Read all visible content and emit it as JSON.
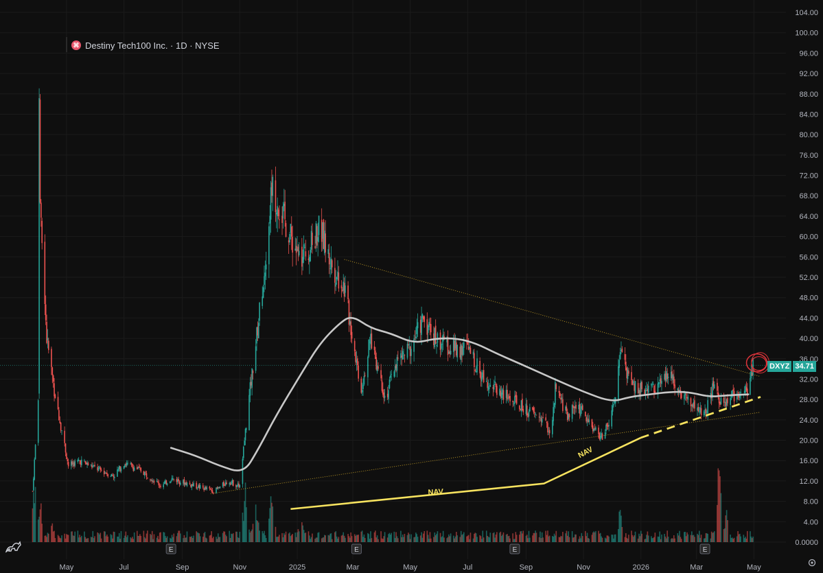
{
  "legend": {
    "logo_glyph": "⌘",
    "title": "Destiny Tech100 Inc. · 1D · NYSE"
  },
  "price_tag": {
    "ticker": "DXYZ",
    "price": "34.71",
    "color": "#26a69a"
  },
  "colors": {
    "up": "#26a69a",
    "down": "#ef5350",
    "ma": "#c8c8c8",
    "nav": "#f7e35f",
    "trend": "#c9a227",
    "circle": "#e0333a",
    "bg": "#0f0f0f"
  },
  "chart_data": {
    "type": "candlestick",
    "x_ticks": [
      "May",
      "Jul",
      "Sep",
      "Nov",
      "2025",
      "Mar",
      "May",
      "Jul",
      "Sep",
      "Nov",
      "2026",
      "Mar",
      "May"
    ],
    "y_ticks": [
      "104.00",
      "100.00",
      "96.00",
      "92.00",
      "88.00",
      "84.00",
      "80.00",
      "76.00",
      "72.00",
      "68.00",
      "64.00",
      "60.00",
      "56.00",
      "52.00",
      "48.00",
      "44.00",
      "40.00",
      "36.00",
      "32.00",
      "28.00",
      "24.00",
      "20.00",
      "16.00",
      "12.00",
      "8.00",
      "4.00",
      "0.0000"
    ],
    "ylim": [
      0,
      104
    ],
    "last_price": 34.71,
    "series": [
      {
        "name": "DXYZ",
        "shape": [
          [
            "2024-03-26",
            10
          ],
          [
            "2024-04-01",
            28
          ],
          [
            "2024-04-02",
            90
          ],
          [
            "2024-04-03",
            65
          ],
          [
            "2024-04-10",
            40
          ],
          [
            "2024-04-18",
            30
          ],
          [
            "2024-04-26",
            22
          ],
          [
            "2024-05-03",
            15
          ],
          [
            "2024-05-15",
            16
          ],
          [
            "2024-06-01",
            14.5
          ],
          [
            "2024-06-20",
            13
          ],
          [
            "2024-07-01",
            15.5
          ],
          [
            "2024-07-20",
            14
          ],
          [
            "2024-08-10",
            11
          ],
          [
            "2024-08-20",
            12.5
          ],
          [
            "2024-09-15",
            11
          ],
          [
            "2024-10-05",
            10
          ],
          [
            "2024-10-20",
            12
          ],
          [
            "2024-11-01",
            11
          ],
          [
            "2024-11-06",
            20
          ],
          [
            "2024-11-12",
            30
          ],
          [
            "2024-11-20",
            42
          ],
          [
            "2024-11-28",
            55
          ],
          [
            "2024-12-05",
            70
          ],
          [
            "2024-12-15",
            65
          ],
          [
            "2024-12-25",
            60
          ],
          [
            "2025-01-05",
            55
          ],
          [
            "2025-01-15",
            58
          ],
          [
            "2025-01-25",
            62
          ],
          [
            "2025-02-05",
            55
          ],
          [
            "2025-02-20",
            50
          ],
          [
            "2025-03-01",
            40
          ],
          [
            "2025-03-10",
            30
          ],
          [
            "2025-03-20",
            40
          ],
          [
            "2025-04-05",
            28
          ],
          [
            "2025-04-15",
            35
          ],
          [
            "2025-05-01",
            38
          ],
          [
            "2025-05-15",
            44
          ],
          [
            "2025-05-28",
            40
          ],
          [
            "2025-06-15",
            38
          ],
          [
            "2025-07-01",
            38
          ],
          [
            "2025-07-15",
            33
          ],
          [
            "2025-08-01",
            30
          ],
          [
            "2025-08-15",
            28
          ],
          [
            "2025-09-01",
            26
          ],
          [
            "2025-09-20",
            24
          ],
          [
            "2025-09-28",
            21
          ],
          [
            "2025-10-02",
            30
          ],
          [
            "2025-10-15",
            25
          ],
          [
            "2025-10-25",
            27
          ],
          [
            "2025-11-05",
            24
          ],
          [
            "2025-11-20",
            20.5
          ],
          [
            "2025-11-28",
            23
          ],
          [
            "2025-12-05",
            28
          ],
          [
            "2025-12-10",
            38
          ],
          [
            "2025-12-20",
            31
          ],
          [
            "2026-01-05",
            30
          ],
          [
            "2026-01-20",
            31
          ],
          [
            "2026-02-01",
            33
          ],
          [
            "2026-02-15",
            29
          ],
          [
            "2026-03-01",
            26
          ],
          [
            "2026-03-10",
            25
          ],
          [
            "2026-03-20",
            31
          ],
          [
            "2026-03-28",
            27
          ],
          [
            "2026-04-10",
            29
          ],
          [
            "2026-04-25",
            30
          ],
          [
            "2026-04-30",
            34.71
          ]
        ]
      },
      {
        "name": "moving-average",
        "points": [
          [
            "2024-08-20",
            18.5
          ],
          [
            "2024-09-15",
            17
          ],
          [
            "2024-10-10",
            15
          ],
          [
            "2024-11-05",
            13.5
          ],
          [
            "2024-11-20",
            18
          ],
          [
            "2024-12-10",
            25
          ],
          [
            "2025-01-05",
            33
          ],
          [
            "2025-01-25",
            39
          ],
          [
            "2025-02-15",
            43
          ],
          [
            "2025-02-28",
            44.5
          ],
          [
            "2025-03-20",
            42
          ],
          [
            "2025-04-10",
            41
          ],
          [
            "2025-05-05",
            39
          ],
          [
            "2025-05-28",
            40
          ],
          [
            "2025-06-20",
            40
          ],
          [
            "2025-07-10",
            39
          ],
          [
            "2025-08-01",
            37
          ],
          [
            "2025-09-01",
            34.5
          ],
          [
            "2025-10-01",
            32
          ],
          [
            "2025-11-01",
            29.5
          ],
          [
            "2025-12-01",
            27.5
          ],
          [
            "2025-12-20",
            28.5
          ],
          [
            "2026-01-10",
            29
          ],
          [
            "2026-02-01",
            29.5
          ],
          [
            "2026-02-20",
            29.5
          ],
          [
            "2026-03-15",
            28.5
          ],
          [
            "2026-04-01",
            28.8
          ],
          [
            "2026-04-25",
            29
          ]
        ]
      }
    ],
    "trendlines": [
      {
        "name": "upper",
        "from": [
          "2025-02-20",
          55.5
        ],
        "to": [
          "2026-05-08",
          32.5
        ]
      },
      {
        "name": "lower",
        "from": [
          "2024-10-01",
          9.5
        ],
        "to": [
          "2026-05-08",
          25.5
        ]
      }
    ],
    "nav_line": {
      "label_1": "NAV",
      "label_2": "NAV",
      "solid": [
        [
          "2024-12-25",
          6.5
        ],
        [
          "2025-09-20",
          11.5
        ],
        [
          "2026-01-01",
          20.5
        ]
      ],
      "dashed": [
        [
          "2026-01-01",
          20.5
        ],
        [
          "2026-05-08",
          28.5
        ]
      ]
    },
    "earnings_markers": [
      {
        "date": "2024-08-20",
        "label": "E"
      },
      {
        "date": "2025-03-05",
        "label": "E"
      },
      {
        "date": "2025-08-20",
        "label": "E"
      },
      {
        "date": "2026-03-10",
        "label": "E"
      }
    ],
    "volume_peaks": [
      [
        "2024-03-28",
        14
      ],
      [
        "2024-04-03",
        11
      ],
      [
        "2024-04-15",
        5
      ],
      [
        "2024-11-07",
        13
      ],
      [
        "2024-11-18",
        9
      ],
      [
        "2024-12-05",
        12
      ],
      [
        "2025-01-05",
        6
      ],
      [
        "2025-12-10",
        8
      ],
      [
        "2026-03-25",
        23
      ],
      [
        "2026-04-02",
        7
      ]
    ]
  }
}
